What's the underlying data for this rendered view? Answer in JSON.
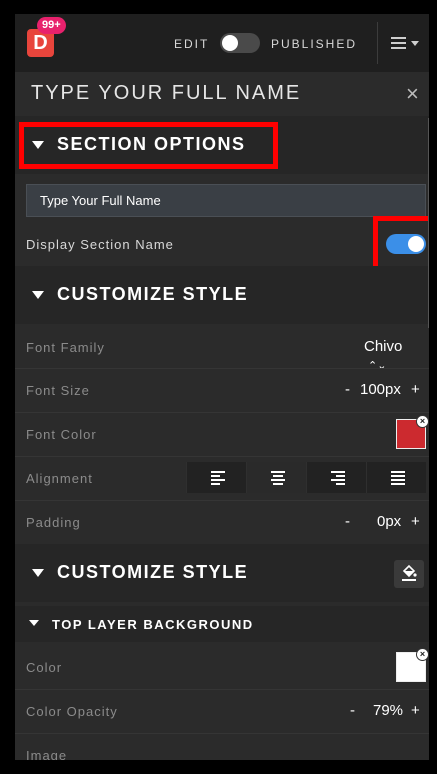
{
  "header": {
    "logo_letter": "D",
    "badge": "99+",
    "edit_label": "EDIT",
    "published_label": "PUBLISHED",
    "publish_toggle_on": false
  },
  "title_bar": {
    "title": "TYPE YOUR FULL NAME",
    "close_glyph": "×"
  },
  "section_options": {
    "heading": "SECTION OPTIONS",
    "name_value": "Type Your Full Name",
    "display_label": "Display Section Name",
    "display_on": true
  },
  "customize_style_1": {
    "heading": "CUSTOMIZE STYLE",
    "font_family_label": "Font Family",
    "font_family_value": "Chivo",
    "font_family_arrows": "⌃⌄",
    "font_size_label": "Font Size",
    "font_size_minus": "-",
    "font_size_value": "100px",
    "font_size_plus": "+",
    "font_color_label": "Font Color",
    "font_color": "#cc2a2f",
    "alignment_label": "Alignment",
    "padding_label": "Padding",
    "padding_minus": "-",
    "padding_value": "0px",
    "padding_plus": "+"
  },
  "customize_style_2": {
    "heading": "CUSTOMIZE STYLE",
    "top_layer_heading": "TOP LAYER BACKGROUND",
    "color_label": "Color",
    "color_value": "#ffffff",
    "opacity_label": "Color Opacity",
    "opacity_minus": "-",
    "opacity_value": "79%",
    "opacity_plus": "+",
    "image_label": "Image"
  },
  "icons": {
    "menu": "hamburger-icon",
    "close": "close-icon",
    "paint": "paint-bucket-icon",
    "clear": "clear-x-icon"
  },
  "colors": {
    "highlight": "#ff0000",
    "toggle_on": "#3b8fe8",
    "brand": "#e8453c",
    "badge": "#e8216c"
  }
}
